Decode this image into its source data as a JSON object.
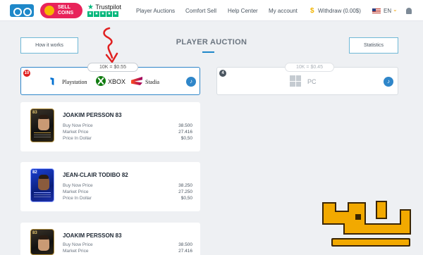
{
  "nav": {
    "sell_top": "SELL",
    "sell_bottom": "COINS",
    "trustpilot": "Trustpilot",
    "links": [
      "Player Auctions",
      "Comfort Sell",
      "Help Center",
      "My account"
    ],
    "withdraw": "Withdraw (0.00$)",
    "language": "EN"
  },
  "header": {
    "how_it_works": "How it works",
    "title": "PLAYER AUCTION",
    "statistics": "Statistics"
  },
  "platforms": [
    {
      "badge": "10",
      "rate": "10K = $0.55",
      "items": [
        "Playstation",
        "XBOX",
        "Stadia"
      ],
      "active": true
    },
    {
      "badge": "4",
      "rate": "10K = $0.45",
      "items": [
        "PC"
      ],
      "active": false
    }
  ],
  "price_labels": [
    "Buy Now Price",
    "Market Price",
    "Price In Dollar"
  ],
  "players": [
    {
      "name": "JOAKIM PERSSON 83",
      "rating": "83",
      "buy_now": "38.500",
      "market": "27.416",
      "dollar": "$0,50"
    },
    {
      "name": "JEAN-CLAIR TODIBO 82",
      "rating": "82",
      "buy_now": "38.250",
      "market": "27.250",
      "dollar": "$0,50"
    },
    {
      "name": "JOAKIM PERSSON 83",
      "rating": "83",
      "buy_now": "38.500",
      "market": "27.416",
      "dollar": "$0,50"
    }
  ],
  "colors": {
    "accent": "#1e88c9",
    "sell": "#e8235a",
    "annotation": "#e02020"
  },
  "icons": [
    "logo-icon",
    "coin-icon",
    "trustpilot-star-icon",
    "dollar-coin-icon",
    "us-flag-icon",
    "chevron-down-icon",
    "bell-icon",
    "playstation-icon",
    "xbox-icon",
    "stadia-icon",
    "windows-icon",
    "sound-icon"
  ]
}
